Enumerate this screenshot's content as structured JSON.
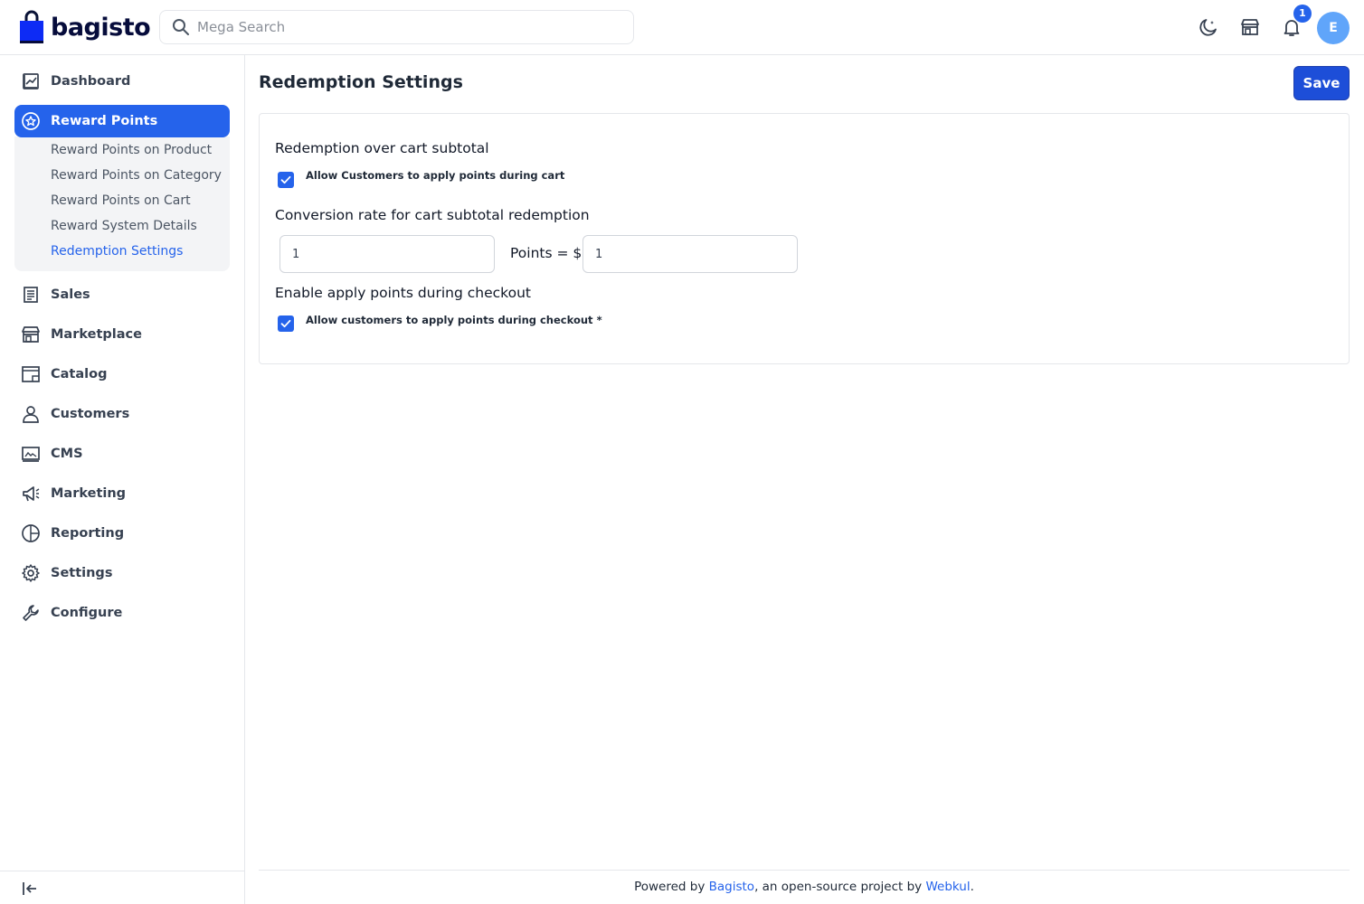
{
  "header": {
    "brand": "bagisto",
    "search_placeholder": "Mega Search",
    "notification_count": "1",
    "avatar_initial": "E",
    "icons": [
      "moon-icon",
      "store-icon",
      "bell-icon"
    ]
  },
  "sidebar": {
    "items": [
      {
        "label": "Dashboard",
        "icon": "chart-icon"
      },
      {
        "label": "Reward Points",
        "icon": "star-icon",
        "active": true
      },
      {
        "label": "Sales",
        "icon": "receipt-icon"
      },
      {
        "label": "Marketplace",
        "icon": "store-icon"
      },
      {
        "label": "Catalog",
        "icon": "catalog-icon"
      },
      {
        "label": "Customers",
        "icon": "person-icon"
      },
      {
        "label": "CMS",
        "icon": "cms-icon"
      },
      {
        "label": "Marketing",
        "icon": "megaphone-icon"
      },
      {
        "label": "Reporting",
        "icon": "pie-icon"
      },
      {
        "label": "Settings",
        "icon": "gear-icon"
      },
      {
        "label": "Configure",
        "icon": "wrench-icon"
      }
    ],
    "submenu": [
      {
        "label": "Reward Points on Product"
      },
      {
        "label": "Reward Points on Category"
      },
      {
        "label": "Reward Points on Cart"
      },
      {
        "label": "Reward System Details"
      },
      {
        "label": "Redemption Settings",
        "current": true
      }
    ]
  },
  "main": {
    "title": "Redemption Settings",
    "save_label": "Save",
    "section1_title": "Redemption over cart subtotal",
    "section1_checkbox_label": "Allow Customers to apply points during cart",
    "section1_checked": true,
    "section2_title": "Conversion rate for cart subtotal redemption",
    "points_value": "1",
    "points_eq_label": "Points = $",
    "dollar_value": "1",
    "section3_title": "Enable apply points during checkout",
    "section3_checkbox_label": "Allow customers to apply points during checkout",
    "section3_required_mark": "*",
    "section3_checked": true
  },
  "footer": {
    "prefix": "Powered by ",
    "link1": "Bagisto",
    "middle": ", an open-source project by ",
    "link2": "Webkul",
    "suffix": "."
  },
  "colors": {
    "accent": "#2563eb",
    "save_button": "#1d4ed8",
    "avatar": "#60a5fa"
  }
}
